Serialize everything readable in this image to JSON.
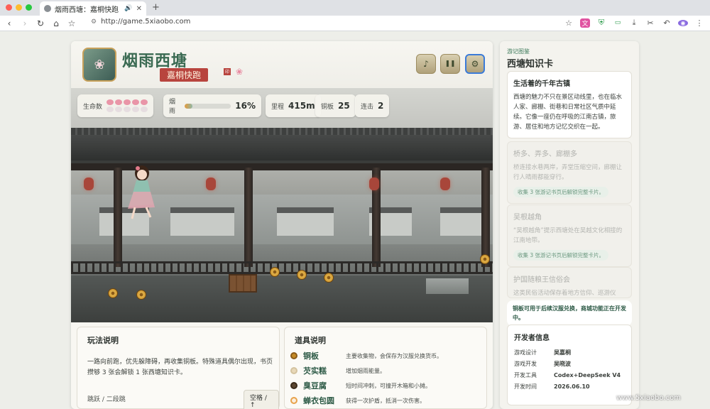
{
  "browser": {
    "tab_title": "烟雨西塘：嘉桐快跑",
    "url": "http://game.5xiaobo.com"
  },
  "colors": {
    "accent": "#3d7a5a",
    "seal_red": "#b8443e",
    "coin": "#c48a26"
  },
  "game": {
    "title": "烟雨西塘",
    "subtitle": "嘉桐快跑",
    "buttons": [
      {
        "name": "music-button",
        "icon": "music-note-icon",
        "glyph": "♪"
      },
      {
        "name": "pause-button",
        "icon": "pause-icon",
        "glyph": "❚❚"
      },
      {
        "name": "settings-button",
        "icon": "gear-icon",
        "glyph": "⚙"
      }
    ],
    "hud": {
      "lives_label": "生命数",
      "lives_total": 10,
      "lives_full": 5,
      "mist_label": "烟雨",
      "mist_value": "16%",
      "mist_fraction": 0.16,
      "distance_label": "里程",
      "distance_value": "415m",
      "coins_label": "铜板",
      "coins_value": "25",
      "combo_label": "连击",
      "combo_value": "2"
    }
  },
  "howto": {
    "title": "玩法说明",
    "text": "一路向前跑，优先躲障碍，再收集铜板。特殊道具偶尔出现，书页攒够 3 张会解锁 1 张西塘知识卡。",
    "controls": "跳跃 / 二段跳",
    "key": "空格 / ↑"
  },
  "items": {
    "title": "道具说明",
    "list": [
      {
        "name": "铜板",
        "desc": "主要收集物，会保存为汉服兑换货币。",
        "color": "#c48a26"
      },
      {
        "name": "芡实糕",
        "desc": "增加烟雨能量。",
        "color": "#e8d8b8"
      },
      {
        "name": "臭豆腐",
        "desc": "短时间冲刺，可撞开木箱和小摊。",
        "color": "#5a4630"
      },
      {
        "name": "蝉衣包圆",
        "desc": "获得一次护盾，抵消一次伤害。",
        "color": "#e8a24a"
      }
    ]
  },
  "sidebar": {
    "kicker": "游记图鉴",
    "title": "西塘知识卡",
    "cards": [
      {
        "title": "生活着的千年古镇",
        "text": "西塘的魅力不只在景区动线里，也在临水人家、廊棚、街巷和日常社区气质中延续。它像一座仍在呼吸的江南古镇，旅游、居住和地方记忆交织在一起。",
        "locked": false
      },
      {
        "title": "桥多、弄多、廊棚多",
        "text": "桥连接水巷两岸，弄堂压缩空间，廊棚让行人晴雨都能穿行。",
        "lock": "收集 3 张游记书页后解锁完整卡片。",
        "locked": true
      },
      {
        "title": "吴根越角",
        "text": "“吴根越角”提示西塘处在吴越文化相接的江南地带。",
        "lock": "收集 3 张游记书页后解锁完整卡片。",
        "locked": true
      },
      {
        "title": "护国随粮王信俗会",
        "text": "这类民俗活动保存着地方信仰、巡游仪",
        "locked": true
      }
    ],
    "note": "铜板可用于后续汉服兑换，商城功能正在开发中。",
    "dev": {
      "title": "开发者信息",
      "rows": [
        {
          "k": "游戏设计",
          "v": "吴嘉桐"
        },
        {
          "k": "游戏开发",
          "v": "吴晓波"
        },
        {
          "k": "开发工具",
          "v": "Codex+DeepSeek V4"
        },
        {
          "k": "开发时间",
          "v": "2026.06.10"
        }
      ]
    }
  },
  "watermark": "www.5xiaobo.com"
}
